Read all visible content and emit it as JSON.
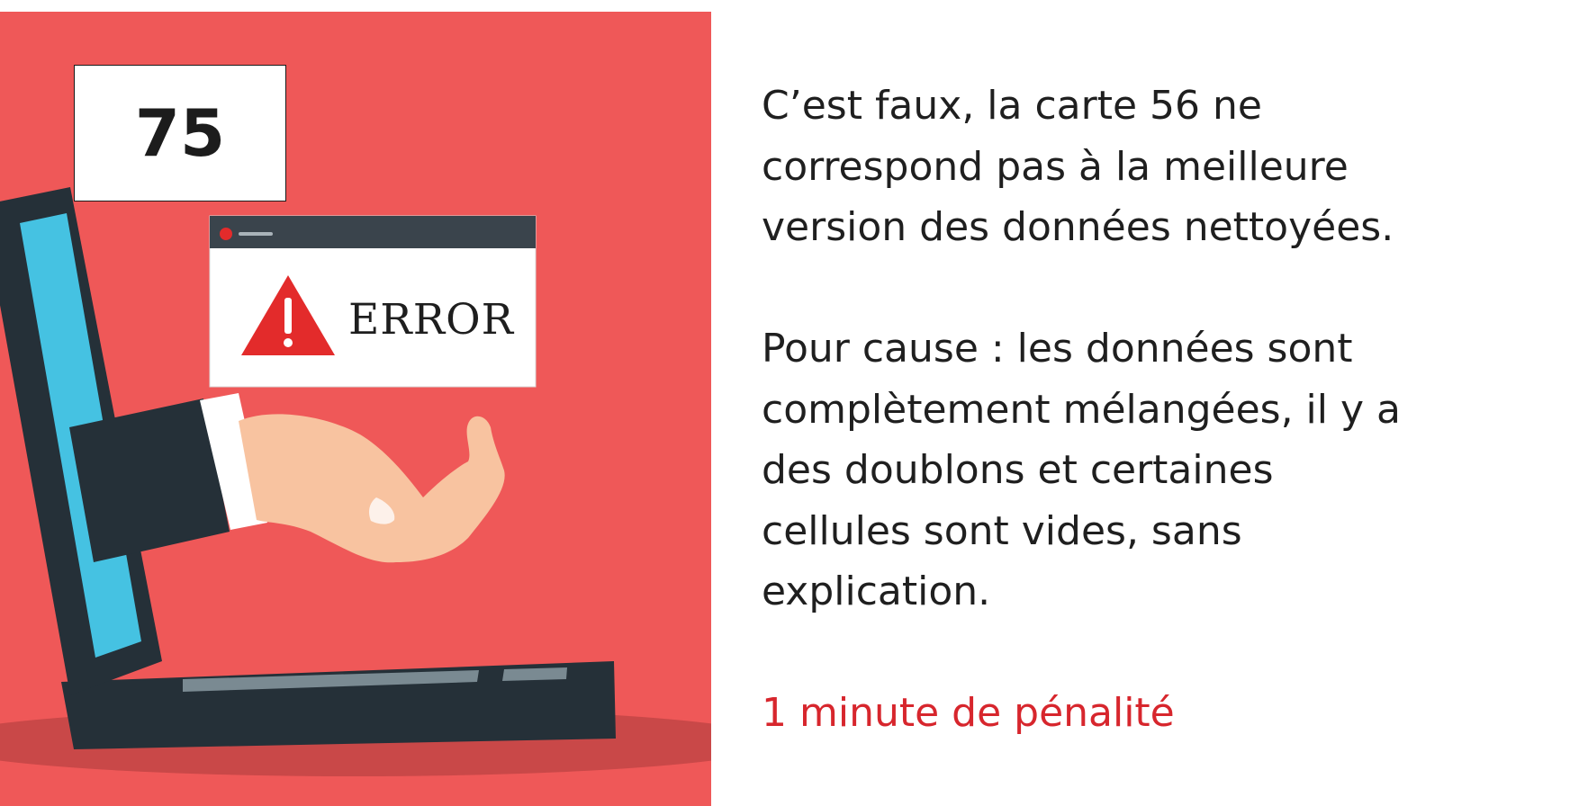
{
  "card": {
    "number": "75",
    "error_dialog_label": "ERROR",
    "message_lines": [
      "C’est faux, la carte 56 ne\ncorrespond pas à la meilleure\nversion des données nettoyées.",
      "Pour cause : les données sont\ncomplètement mélangées, il y a\ndes doublons et certaines\ncellules sont vides, sans\nexplication."
    ],
    "penalty": "1 minute de pénalité"
  },
  "colors": {
    "background_red": "#EF5858",
    "laptop_dark": "#253038",
    "screen_blue": "#45C2E2",
    "error_triangle": "#E32B2B",
    "penalty_text": "#D7262D",
    "skin": "#F8C3A0"
  },
  "icons": {
    "warning": "warning-triangle-icon",
    "window_close_dot": "red-dot-icon"
  }
}
